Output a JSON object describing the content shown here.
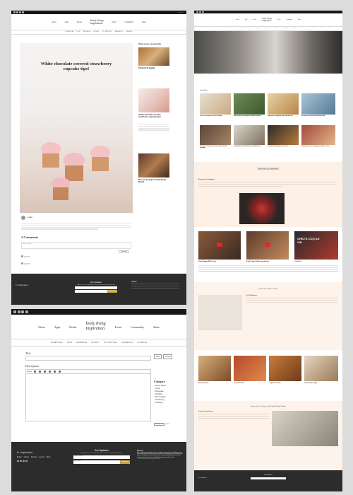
{
  "site": {
    "logo_line1": "lively living",
    "logo_line2": "inspiration.",
    "nav": [
      "About",
      "Apps",
      "Books",
      "Event",
      "Community",
      "Share"
    ],
    "subnav": [
      "HOMESTEAD",
      "FOOD",
      "BEVERAGE",
      "HOLIDAY",
      "DIY CRAFTING",
      "GARDENING",
      "CLEANING"
    ],
    "topbar_text": "About Us"
  },
  "post": {
    "title": "White chocolate covered strawberry cupcake tips!",
    "sidebar_heading": "Other posts you may like",
    "sidebar": [
      "Perfect Pie Dough",
      "White chocolate covered strawberry cupcake tips!",
      "How to Arrange a Charcuterie Board"
    ],
    "author": "cookie",
    "comments_heading": "2 Comments",
    "comment_placeholder": "Add a comment",
    "comment_button": "Comment",
    "commenter": "awesome"
  },
  "footer": {
    "brand": "lv. inspiration",
    "opt_title": "Get Updates",
    "opt_text": "Subscribe to our newsletter for more content and special discounts!",
    "subscribe": "Subscribe",
    "about_title": "About",
    "copyright": "© 2024 lively inspiration"
  },
  "home": {
    "hero_label": "Latest Posts",
    "posts": [
      "Fresh Ice Cream Inspired by Flavor Tradition",
      "Embracing the First Springtime for Outdoor Gardening",
      "Balanced Way to Bring More Home Fruit and Color",
      "Discovering the Good Flavors Beyond Your Walls",
      "Art Culinary Transformations: Home-Made Artful Shelf Decoration",
      "Everything Fresh Herbs Bring You In a Beautiful Corner",
      "Artful Table Styling with Vintage Flourish",
      "Winning Easy Dessert Combinations for Beginners to Love"
    ],
    "welcome_title": "Welcome to Liv Inspiration!",
    "welcome_sub": "Home to all our recipes, videos, and books.",
    "about_heading": "Everyone at Liv Inspiration",
    "videos": [
      "World Winning BBQ Recipes",
      "Earth's Spiced: Mediterranean Roots",
      "Coq Au Vin"
    ],
    "video_badge": "CHEZ'S COQ AU VIN",
    "library_title": "Unlock Your Dinner Library",
    "library_heading": "Liv Publications",
    "books": [
      "Kitchen Basket Pleat",
      "Savory Local Pleasant",
      "Crispy Roasted Chicken",
      "Statement Kitchen Delight"
    ],
    "inspo_title": "Explore Your Creativity with Global Design Masters",
    "inspo_heading": "Create a Guest House"
  },
  "editor": {
    "title_label": "Title",
    "description_label": "Description",
    "category_label": "Category",
    "categories": [
      "Home Decor",
      "Food",
      "Beverage",
      "Holidays",
      "DIY Crafting",
      "Gardening",
      "Cleaning"
    ],
    "save_button": "Save",
    "cancel_button": "Cancel",
    "choose_file": "Choose file",
    "no_file": "no file",
    "mode_label": "Normal",
    "footer_about": "At Lively Living inspiration, we're excited to share our favorite discoveries, from cooking tips and decor ideas to lifestyle and travel. Get inspired by our ideas and share your favorite bits with us on Social Media! We're always searching for fresh ideas and will help inspire you all in a few.",
    "footer_links": [
      "Books",
      "Videos",
      "Recipes",
      "Events",
      "Write"
    ],
    "email_placeholder": "Email Address",
    "name_placeholder": "First Name",
    "copyright": "© 2023 lively living inspiration. All rights reserved."
  }
}
